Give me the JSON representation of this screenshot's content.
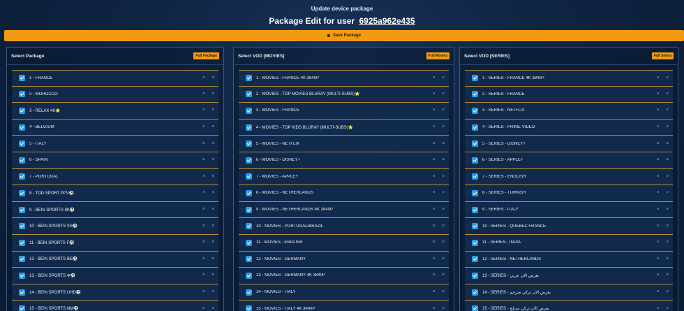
{
  "header": {
    "top_title": "Update device package",
    "title_prefix": "Package Edit for user",
    "user_id": "6925a962e435"
  },
  "save_button": {
    "label": "Save Package"
  },
  "colors": {
    "accent": "#f29a13",
    "checkbox": "#2f9be0",
    "row_border": "#b88c3a"
  },
  "panels": [
    {
      "title": "Select Package",
      "full_label": "Full Package",
      "items": [
        "1 - FRANCE",
        "2 - MOROCCO",
        "3 - RELAX 4K⭐",
        "4 - BELGIUM",
        "5 - ITALY",
        "6 - SPAIN",
        "7 - PORTUGAL",
        "8 - TOD SPORT PPV⚽",
        "9 - BEIN SPORTS 8K⚽",
        "10 - BEIN SPORTS SS⚽",
        "11 - BEIN SPORTS F⚽",
        "12 - BEIN SPORTS BE⚽",
        "13 - BEIN SPORTS ❄⚽",
        "14 - BEIN SPORTS UHD⚽",
        "15 - BEIN SPORTS NM⚽"
      ]
    },
    {
      "title": "Select VOD [MOVIES]",
      "full_label": "Full Movies",
      "items": [
        "1 - MOVIES - FRANCE 4K 3840P",
        "2 - MOVIES - TOP MOVIES BLURAY (MULTI-SUBS)⭐",
        "3 - MOVIES - FRANCE",
        "4 - MOVIES - TOP KIDS BLURAY (MULTI-SUBS)⭐",
        "5 - MOVIES - NETFLIX",
        "6 - MOVIES - DISNEY+",
        "7 - MOVIES - APPLE+",
        "8 - MOVIES - NETHERLANDS",
        "9 - MOVIES - NETHERLANDS 4K 3840P",
        "10 - MOVIES - PORTUGAL/BRAZIL",
        "11 - MOVIES - ENGLISH",
        "12 - MOVIES - GERMANY",
        "13 - MOVIES - GERMANY 4K 3840P",
        "14 - MOVIES - ITALY",
        "15 - MOVIES - ITALY 4K 3840P"
      ]
    },
    {
      "title": "Select VOD [SERIES]",
      "full_label": "Full Series",
      "items": [
        "1 - SERIES - FRANCE 4K 3840P",
        "2 - SERIES - FRANCE",
        "3 - SERIES - NETFLIX",
        "4 - SERIES - PRIME VIDEO",
        "5 - SERIES - DISNEY+",
        "6 - SERIES - APPLE+",
        "7 - SERIES - ENGLISH",
        "8 - SERIES - TURKISH",
        "9 - SERIES - ITALY",
        "10 - SERIES - QUÉBEC FRANCE",
        "11 - SERIES - INDIA",
        "12 - SERIES - NETHERLANDS",
        "13 - SERIES - يعرض الان عربي",
        "14 - SERIES - يعرض الان تركي مترجم",
        "15 - SERIES - يعرض الان تركي مدبلج"
      ]
    }
  ]
}
